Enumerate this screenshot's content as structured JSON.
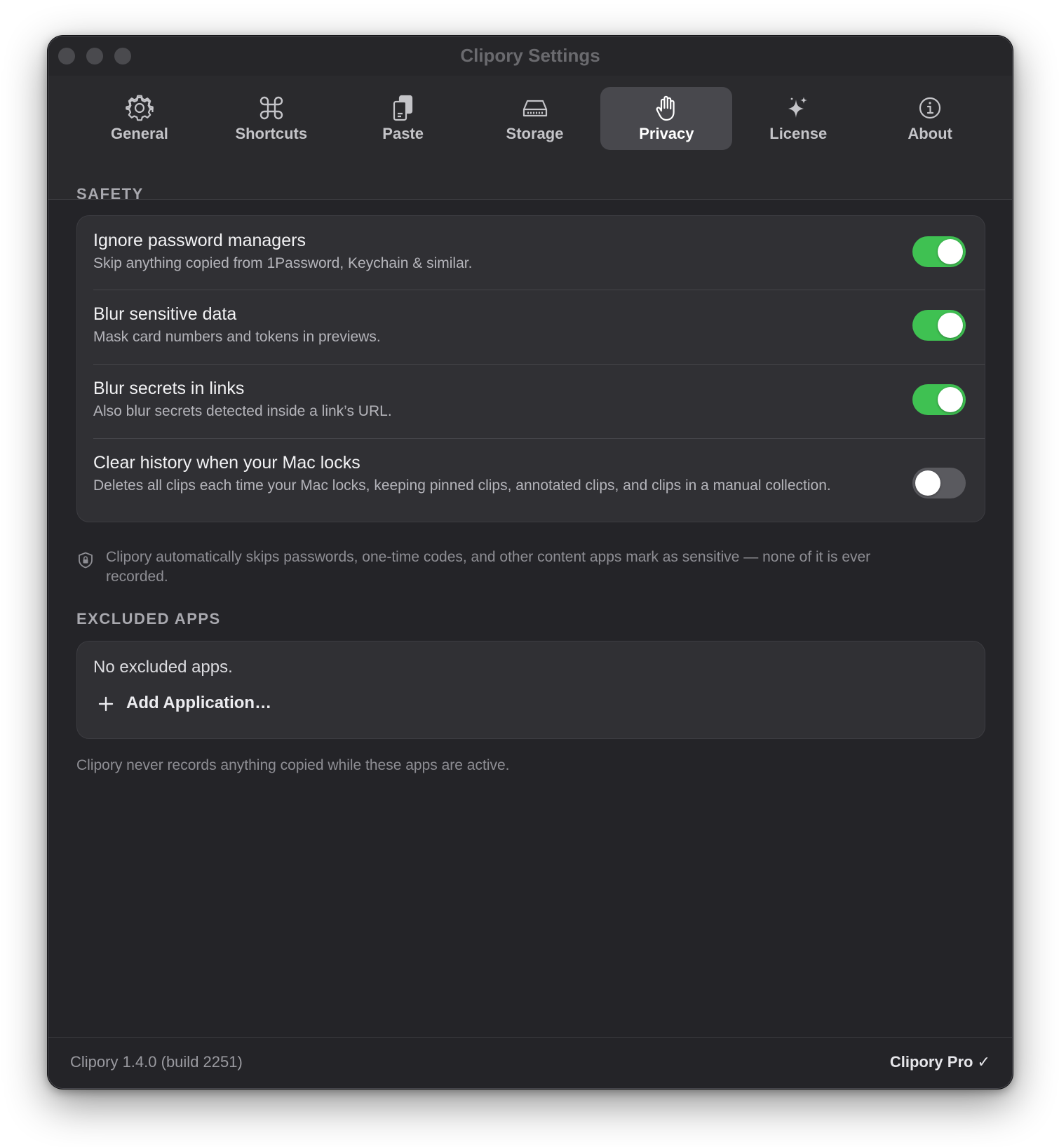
{
  "window": {
    "title": "Clipory Settings"
  },
  "tabs": [
    {
      "label": "General",
      "icon": "gear-icon",
      "selected": false
    },
    {
      "label": "Shortcuts",
      "icon": "command-icon",
      "selected": false
    },
    {
      "label": "Paste",
      "icon": "clipboard-icon",
      "selected": false
    },
    {
      "label": "Storage",
      "icon": "drive-icon",
      "selected": false
    },
    {
      "label": "Privacy",
      "icon": "hand-icon",
      "selected": true
    },
    {
      "label": "License",
      "icon": "sparkles-icon",
      "selected": false
    },
    {
      "label": "About",
      "icon": "info-icon",
      "selected": false
    }
  ],
  "safety": {
    "header": "SAFETY",
    "rows": [
      {
        "title": "Ignore password managers",
        "description": "Skip anything copied from 1Password, Keychain & similar.",
        "enabled": true
      },
      {
        "title": "Blur sensitive data",
        "description": "Mask card numbers and tokens in previews.",
        "enabled": true
      },
      {
        "title": "Blur secrets in links",
        "description": "Also blur secrets detected inside a link’s URL.",
        "enabled": true
      },
      {
        "title": "Clear history when your Mac locks",
        "description": "Deletes all clips each time your Mac locks, keeping pinned clips, annotated clips, and clips in a manual collection.",
        "enabled": false
      }
    ],
    "note": "Clipory automatically skips passwords, one-time codes, and other content apps mark as sensitive — none of it is ever recorded."
  },
  "excluded": {
    "header": "EXCLUDED APPS",
    "empty_text": "No excluded apps.",
    "add_label": "Add Application…",
    "note": "Clipory never records anything copied while these apps are active."
  },
  "footer": {
    "version": "Clipory 1.4.0 (build 2251)",
    "pro": "Clipory Pro ✓"
  },
  "colors": {
    "toggle_on": "#3fc152",
    "toggle_off": "#5a5a5f",
    "window_bg": "#242428",
    "card_bg": "#303034",
    "selected_tab": "#48484d"
  }
}
